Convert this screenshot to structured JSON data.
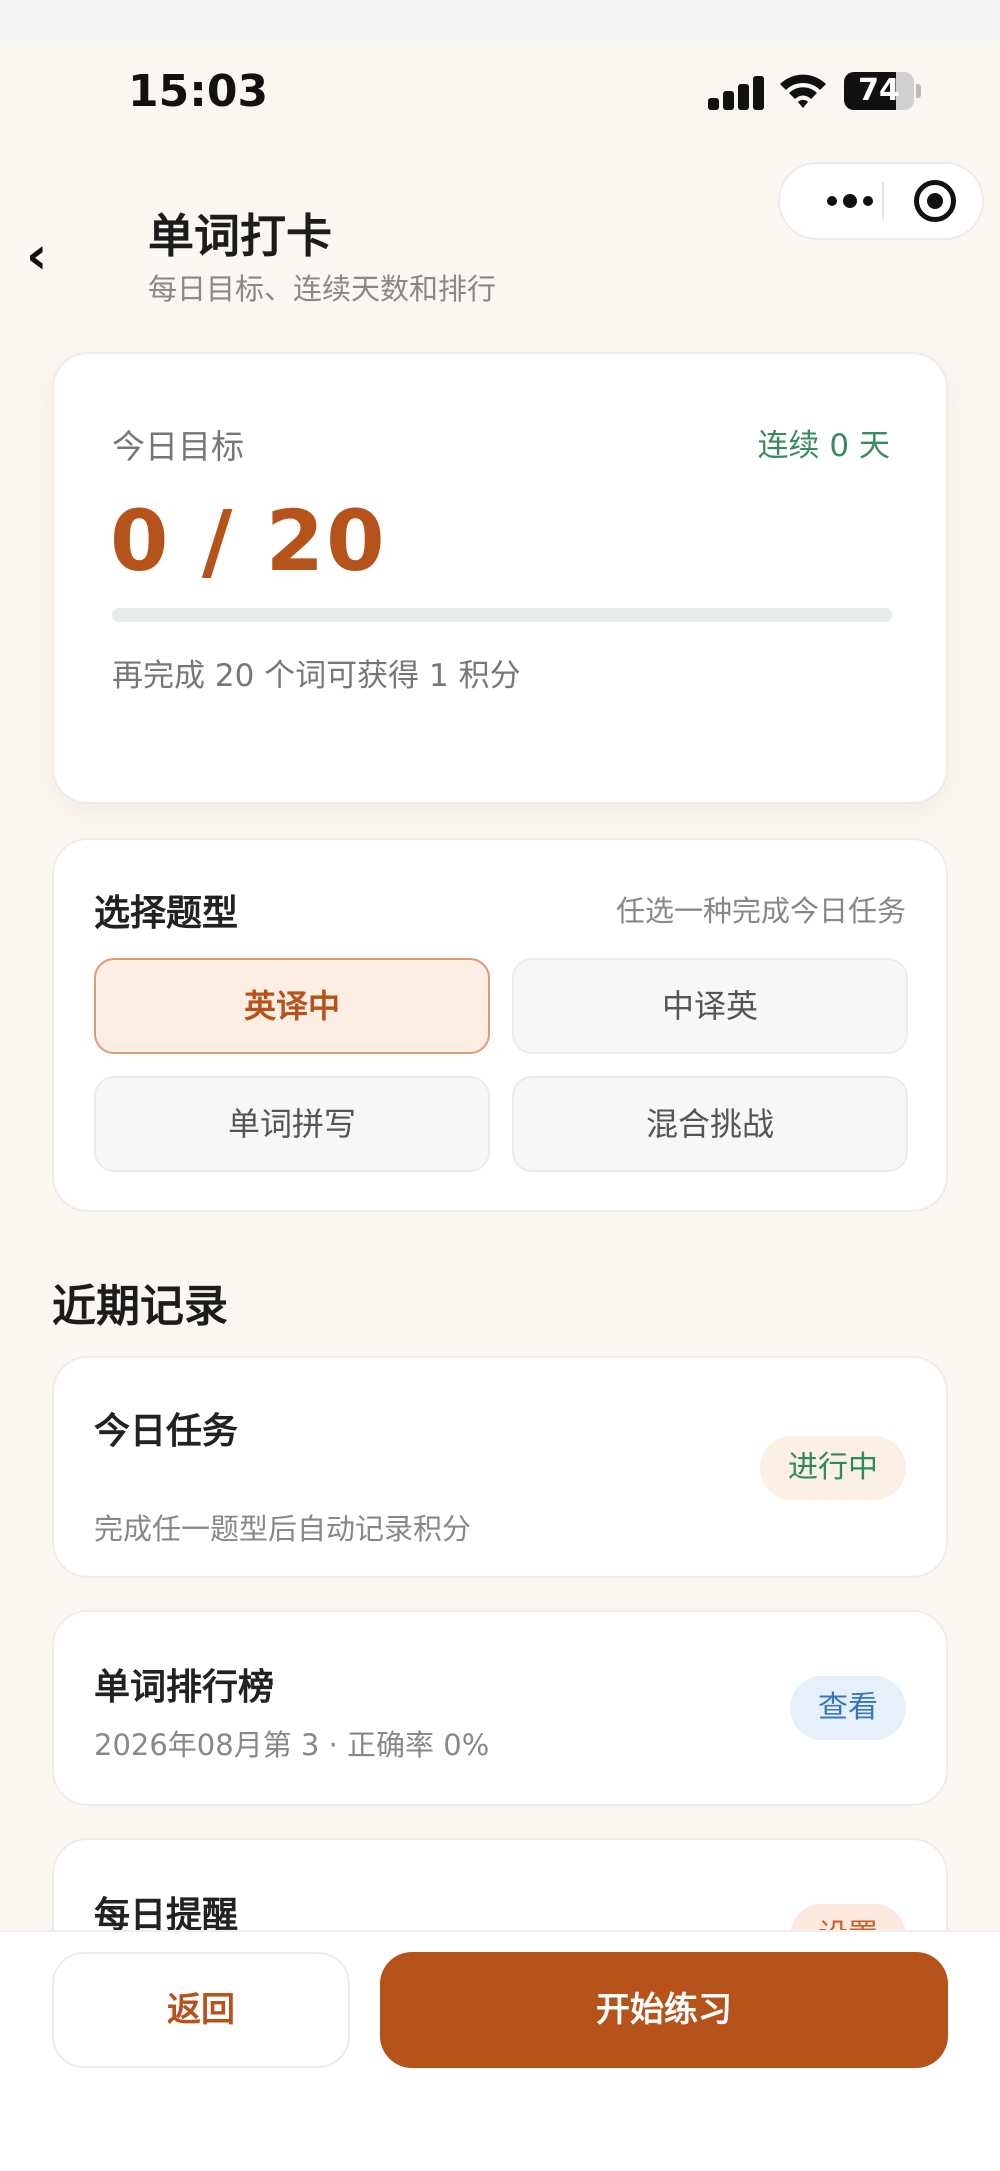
{
  "status_bar": {
    "time": "15:03",
    "battery": "74",
    "battery_level": 0.74
  },
  "capsule": {
    "more_icon": "more-dots-icon",
    "close_icon": "target-icon"
  },
  "header": {
    "back_icon": "chevron-left-icon",
    "back_glyph": "‹",
    "title": "单词打卡",
    "subtitle": "每日目标、连续天数和排行"
  },
  "goal": {
    "label": "今日目标",
    "streak": "连续 0 天",
    "progress_text": "0 / 20",
    "progress_fraction": 0,
    "hint": "再完成 20 个词可获得 1 积分"
  },
  "question_types": {
    "heading": "选择题型",
    "note": "任选一种完成今日任务",
    "options": [
      {
        "label": "英译中",
        "selected": true
      },
      {
        "label": "中译英",
        "selected": false
      },
      {
        "label": "单词拼写",
        "selected": false
      },
      {
        "label": "混合挑战",
        "selected": false
      }
    ]
  },
  "records": {
    "heading": "近期记录",
    "items": [
      {
        "title": "今日任务",
        "desc": "完成任一题型后自动记录积分",
        "badge": "进行中"
      },
      {
        "title": "单词排行榜",
        "desc": "2026年08月第 3 · 正确率 0%",
        "badge": "查看"
      },
      {
        "title": "每日提醒",
        "desc": "",
        "badge": "设置"
      }
    ]
  },
  "footer": {
    "back_label": "返回",
    "start_label": "开始练习"
  },
  "colors": {
    "accent": "#b5531b",
    "streak_green": "#3a8a5f",
    "background": "#faf6f2"
  }
}
